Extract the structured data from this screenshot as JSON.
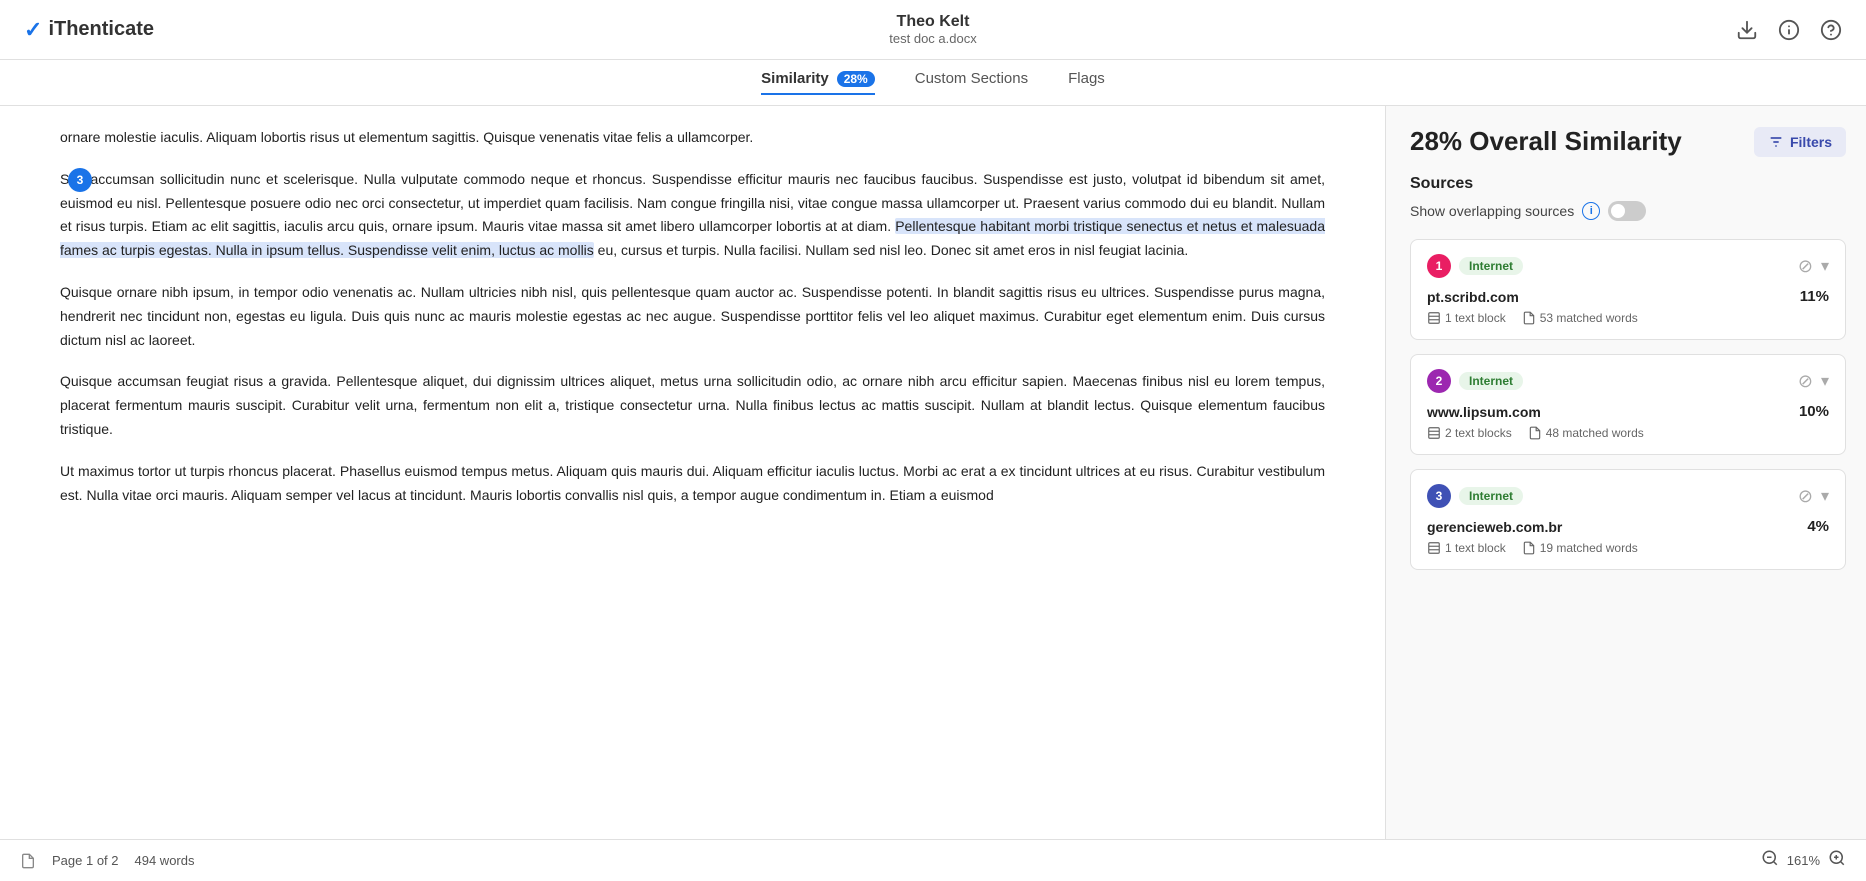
{
  "header": {
    "logo": "iThenticate",
    "check_mark": "✓",
    "user_name": "Theo Kelt",
    "doc_file": "test doc a.docx",
    "download_icon": "⬇",
    "info_icon": "ⓘ",
    "help_icon": "?"
  },
  "tabs": [
    {
      "id": "similarity",
      "label": "Similarity",
      "badge": "28%",
      "active": true
    },
    {
      "id": "custom-sections",
      "label": "Custom Sections",
      "badge": null,
      "active": false
    },
    {
      "id": "flags",
      "label": "Flags",
      "badge": null,
      "active": false
    }
  ],
  "document": {
    "paragraph1": "ornare molestie iaculis. Aliquam lobortis risus ut elementum sagittis. Quisque venenatis vitae felis a ullamcorper.",
    "paragraph2": "Sed accumsan sollicitudin nunc et scelerisque. Nulla vulputate commodo neque et rhoncus. Suspendisse efficitur mauris nec faucibus faucibus. Suspendisse est justo, volutpat id bibendum sit amet, euismod eu nisl. Pellentesque posuere odio nec orci consectetur, ut imperdiet quam facilisis. Nam congue fringilla nisi, vitae congue massa ullamcorper ut. Praesent varius commodo dui eu blandit. Nullam et risus turpis. Etiam ac elit sagittis, iaculis arcu quis, ornare ipsum. Mauris vitae massa sit amet libero ullamcorper lobortis at at diam. Pellentesque habitant morbi tristique senectus et netus et malesuada fames ac turpis egestas. Nulla in ipsum tellus. Suspendisse velit enim, luctus ac mollis eu, cursus et turpis. Nulla facilisi. Nullam sed nisl leo. Donec sit amet eros in nisl feugiat lacinia.",
    "paragraph3": "Quisque ornare nibh ipsum, in tempor odio venenatis ac. Nullam ultricies nibh nisl, quis pellentesque quam auctor ac. Suspendisse potenti. In blandit sagittis risus eu ultrices. Suspendisse purus magna, hendrerit nec tincidunt non, egestas eu ligula. Duis quis nunc ac mauris molestie egestas ac nec augue. Suspendisse porttitor felis vel leo aliquet maximus. Curabitur eget elementum enim. Duis cursus dictum nisl ac laoreet.",
    "paragraph4": "Quisque accumsan feugiat risus a gravida. Pellentesque aliquet, dui dignissim ultrices aliquet, metus urna sollicitudin odio, ac ornare nibh arcu efficitur sapien. Maecenas finibus nisl eu lorem tempus, placerat fermentum mauris suscipit. Curabitur velit urna, fermentum non elit a, tristique consectetur urna. Nulla finibus lectus ac mattis suscipit. Nullam at blandit lectus. Quisque elementum faucibus tristique.",
    "paragraph5": "Ut maximus tortor ut turpis rhoncus placerat. Phasellus euismod tempus metus. Aliquam quis mauris dui. Aliquam efficitur iaculis luctus. Morbi ac erat a ex tincidunt ultrices at eu risus. Curabitur vestibulum est. Nulla vitae orci mauris. Aliquam semper vel lacus at tincidunt. Mauris lobortis convallis nisl quis, a tempor augue condimentum in. Etiam a euismod"
  },
  "right_panel": {
    "similarity_title": "28% Overall Similarity",
    "filters_btn": "Filters",
    "sources_title": "Sources",
    "overlapping_label": "Show overlapping sources",
    "sources": [
      {
        "number": 1,
        "number_color": "#e91e63",
        "type": "Internet",
        "url": "pt.scribd.com",
        "percentage": "11%",
        "text_blocks": "1 text block",
        "matched_words": "53 matched words"
      },
      {
        "number": 2,
        "number_color": "#9c27b0",
        "type": "Internet",
        "url": "www.lipsum.com",
        "percentage": "10%",
        "text_blocks": "2 text blocks",
        "matched_words": "48 matched words"
      },
      {
        "number": 3,
        "number_color": "#3f51b5",
        "type": "Internet",
        "url": "gerencieweb.com.br",
        "percentage": "4%",
        "text_blocks": "1 text block",
        "matched_words": "19 matched words"
      }
    ]
  },
  "bottom_bar": {
    "page_label": "Page 1 of 2",
    "word_count": "494 words",
    "zoom_level": "161%"
  }
}
